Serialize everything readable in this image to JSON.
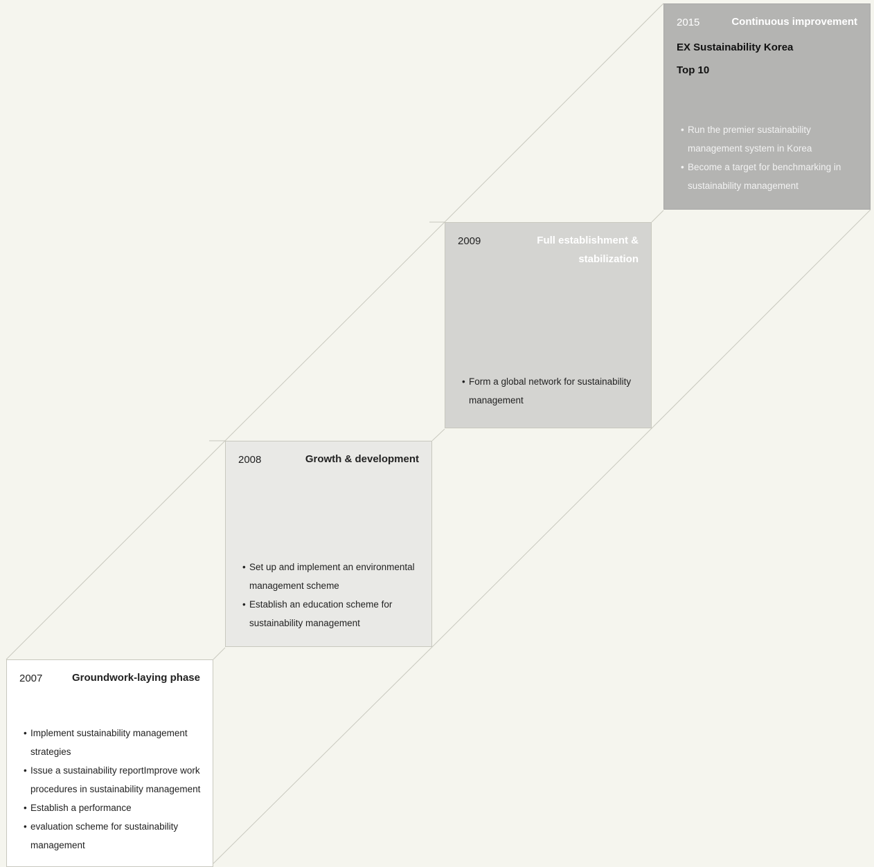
{
  "stages": [
    {
      "year": "2007",
      "phase": "Groundwork-laying phase",
      "bullets": [
        "Implement sustainability management strategies",
        "Issue a sustainability reportImprove work procedures in sustainability management",
        "Establish a performance",
        "evaluation scheme for sustainability management"
      ],
      "background": "#ffffff"
    },
    {
      "year": "2008",
      "phase": "Growth & development",
      "bullets": [
        "Set up and implement an environmental management scheme",
        "Establish an education scheme for sustainability management"
      ],
      "background": "#e9e9e6"
    },
    {
      "year": "2009",
      "phase": "Full establishment & stabilization",
      "bullets": [
        "Form a global network for sustainability management"
      ],
      "background": "#d4d4d1"
    },
    {
      "year": "2015",
      "phase": "Continuous improvement",
      "goal_line1": "EX Sustainability Korea",
      "goal_line2": "Top 10",
      "bullets": [
        "Run the premier sustainability management system in Korea",
        "Become a target for benchmarking in sustainability management"
      ],
      "background": "#b4b4b2"
    }
  ],
  "colors": {
    "page_background": "#f5f5ee",
    "connector_line": "#c8c8be"
  }
}
